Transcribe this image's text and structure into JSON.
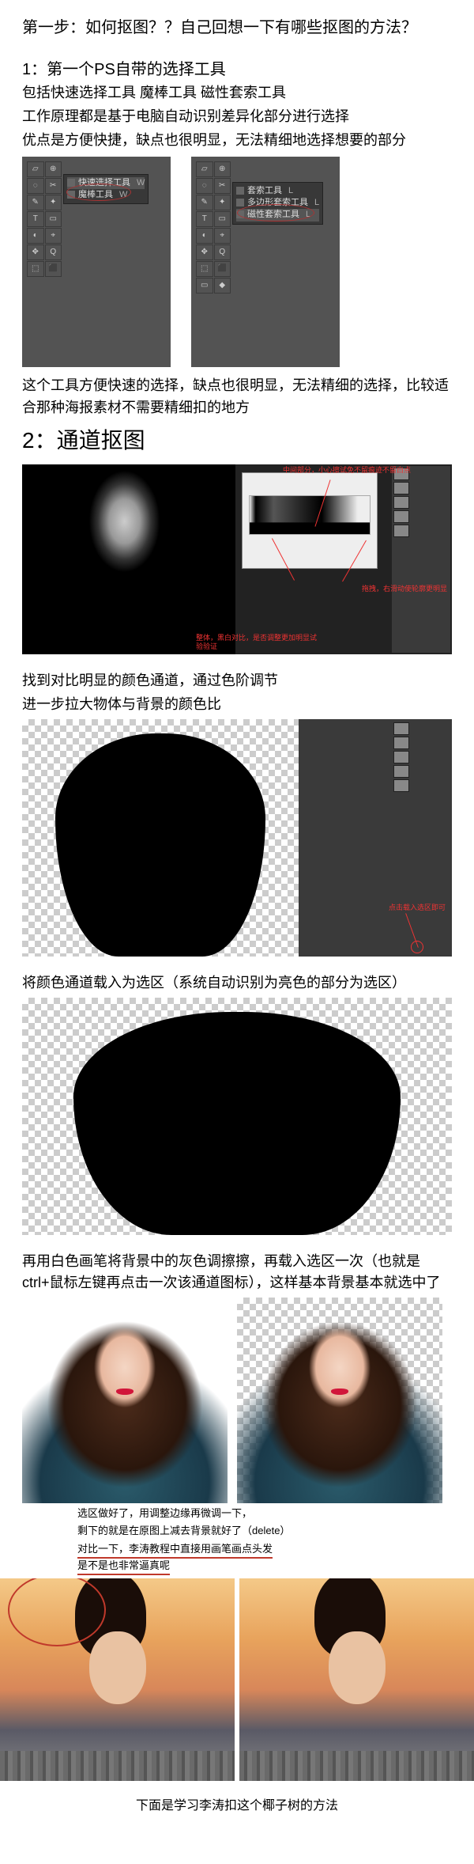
{
  "step1": {
    "title": "第一步：如何抠图？？自己回想一下有哪些抠图的方法？",
    "sec1_head": "1：第一个PS自带的选择工具",
    "sec1_l1": "包括快速选择工具 魔棒工具 磁性套索工具",
    "sec1_l2": "工作原理都是基于电脑自动识别差异化部分进行选择",
    "sec1_l3": "优点是方便快捷，缺点也很明显，无法精细地选择想要的部分",
    "flyout_a": {
      "r1": "快速选择工具",
      "r2": "魔棒工具",
      "letter": "W"
    },
    "flyout_b": {
      "r1": "套索工具",
      "r2": "多边形套索工具",
      "r3": "磁性套索工具",
      "letter": "L"
    },
    "sec1_summary": "这个工具方便快速的选择，缺点也很明显，无法精细的选择，比较适合那种海报素材不需要精细扣的地方"
  },
  "step2": {
    "title": "2：通道抠图",
    "note_top": "中间部分，小心擦试免不留痕迹不留白点",
    "note_right": "拖拽，右滑动使轮廓更明显",
    "note_bottom": "整体，黑白对比，是否调整更加明显试验验证",
    "caption1": "找到对比明显的颜色通道，通过色阶调节",
    "caption1b": "进一步拉大物体与背景的颜色比",
    "note_load": "点击载入选区即可",
    "caption2": "将颜色通道载入为选区（系统自动识别为亮色的部分为选区）",
    "caption3": "再用白色画笔将背景中的灰色调擦擦，再载入选区一次（也就是ctrl+鼠标左键再点击一次该通道图标），这样基本背景基本就选中了",
    "caption4a": "选区做好了，用调整边缘再微调一下，",
    "caption4b": "剩下的就是在原图上减去背景就好了（delete）",
    "caption5a": "对比一下，李涛教程中直接用画笔画点头发",
    "caption5b": "是不是也非常逼真呢"
  },
  "footer": "下面是学习李涛扣这个椰子树的方法"
}
